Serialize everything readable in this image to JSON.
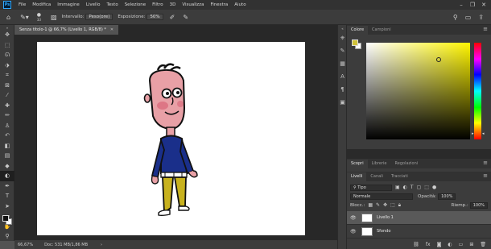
{
  "menubar": {
    "logo": "Ps",
    "items": [
      "File",
      "Modifica",
      "Immagine",
      "Livello",
      "Testo",
      "Selezione",
      "Filtro",
      "3D",
      "Visualizza",
      "Finestra",
      "Aiuto"
    ],
    "window_controls": [
      "–",
      "❐",
      "✕"
    ]
  },
  "options_bar": {
    "brush_size": "33",
    "interval_label": "Intervallo:",
    "interval_value": "Peso(ore)",
    "exposure_label": "Esposizione:",
    "exposure_value": "50%"
  },
  "document": {
    "tab_title": "Senza titolo-1 @ 66,7% (Livello 1, RGB/8) *",
    "zoom": "66,67%",
    "doc_info": "Doc: 531 MB/1,86 MB",
    "status_arrow": "›"
  },
  "color_panel": {
    "tabs": [
      "Colore",
      "Campioni"
    ],
    "foreground_color": "#d1c33a",
    "background_color": "#ffffff"
  },
  "properties_panel": {
    "tabs": [
      "Scopri",
      "Librerie",
      "Regolazioni"
    ]
  },
  "layers_panel": {
    "tabs": [
      "Livelli",
      "Canali",
      "Tracciati"
    ],
    "filter_label": "Tipo",
    "blend_mode": "Normale",
    "opacity_label": "Opacità:",
    "opacity_value": "100%",
    "lock_label": "Blocc.:",
    "fill_label": "Riemp.:",
    "fill_value": "100%",
    "layers": [
      {
        "name": "Livello 1",
        "selected": true
      },
      {
        "name": "Sfondo",
        "selected": false
      }
    ]
  }
}
